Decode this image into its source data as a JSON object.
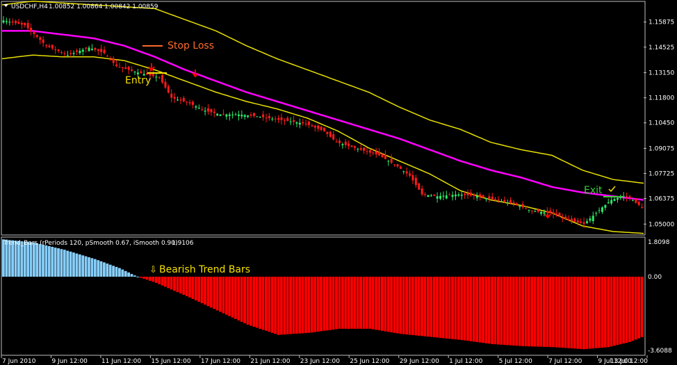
{
  "header": {
    "symbol": "USDCHF,H4",
    "ohlc": "1.00852 1.00864 1.00842 1.00859"
  },
  "indicator": {
    "caption": "Trend_Bars  (rPeriods 120, pSmooth 0.67, iSmooth 0.90)",
    "current_value": "1.9106"
  },
  "annotations": {
    "stop_loss": "Stop Loss",
    "entry": "Entry",
    "exit": "Exit",
    "bearish": "Bearish Trend Bars",
    "colors": {
      "stop_loss": "#ff6a2a",
      "entry": "#f5e000",
      "exit": "#35d135",
      "bearish": "#f5e000"
    }
  },
  "chart_data": [
    {
      "type": "candlestick",
      "title": "USDCHF,H4",
      "price_ticks": [
        "1.15875",
        "1.14525",
        "1.13150",
        "1.11800",
        "1.10450",
        "1.09075",
        "1.07725",
        "1.06375",
        "1.05000"
      ],
      "ylim": [
        1.0445,
        1.1695
      ],
      "x_ticks": [
        "7 Jun 2010",
        "9 Jun 12:00",
        "11 Jun 12:00",
        "15 Jun 12:00",
        "17 Jun 12:00",
        "21 Jun 12:00",
        "23 Jun 12:00",
        "25 Jun 12:00",
        "29 Jun 12:00",
        "1 Jul 12:00",
        "5 Jul 12:00",
        "7 Jul 12:00",
        "9 Jul 12:00",
        "13 Jul 12:00"
      ],
      "close_path": [
        [
          0,
          1.16
        ],
        [
          8,
          1.157
        ],
        [
          15,
          1.146
        ],
        [
          22,
          1.141
        ],
        [
          29,
          1.145
        ],
        [
          34,
          1.142
        ],
        [
          38,
          1.135
        ],
        [
          44,
          1.132
        ],
        [
          49,
          1.13
        ],
        [
          52,
          1.129
        ],
        [
          56,
          1.118
        ],
        [
          62,
          1.115
        ],
        [
          67,
          1.111
        ],
        [
          72,
          1.109
        ],
        [
          78,
          1.109
        ],
        [
          84,
          1.108
        ],
        [
          92,
          1.106
        ],
        [
          96,
          1.105
        ],
        [
          100,
          1.104
        ],
        [
          106,
          1.1
        ],
        [
          110,
          1.094
        ],
        [
          114,
          1.092
        ],
        [
          118,
          1.09
        ],
        [
          124,
          1.087
        ],
        [
          130,
          1.081
        ],
        [
          134,
          1.076
        ],
        [
          138,
          1.066
        ],
        [
          143,
          1.065
        ],
        [
          150,
          1.066
        ],
        [
          156,
          1.065
        ],
        [
          162,
          1.063
        ],
        [
          168,
          1.061
        ],
        [
          174,
          1.057
        ],
        [
          180,
          1.056
        ],
        [
          186,
          1.052
        ],
        [
          191,
          1.05
        ],
        [
          197,
          1.059
        ],
        [
          200,
          1.063
        ],
        [
          204,
          1.065
        ],
        [
          206,
          1.064
        ],
        [
          210,
          1.059
        ]
      ],
      "series": [
        {
          "name": "",
          "color": "#ff00ff",
          "values": [
            [
              0,
              1.154
            ],
            [
              10,
              1.154
            ],
            [
              20,
              1.152
            ],
            [
              30,
              1.15
            ],
            [
              40,
              1.146
            ],
            [
              50,
              1.14
            ],
            [
              60,
              1.133
            ],
            [
              70,
              1.127
            ],
            [
              80,
              1.121
            ],
            [
              90,
              1.116
            ],
            [
              100,
              1.111
            ],
            [
              110,
              1.106
            ],
            [
              120,
              1.101
            ],
            [
              130,
              1.096
            ],
            [
              140,
              1.09
            ],
            [
              150,
              1.084
            ],
            [
              160,
              1.079
            ],
            [
              170,
              1.075
            ],
            [
              180,
              1.07
            ],
            [
              190,
              1.067
            ],
            [
              200,
              1.065
            ],
            [
              210,
              1.063
            ]
          ]
        },
        {
          "name": "",
          "color": "#e8e000",
          "values": [
            [
              0,
              1.168
            ],
            [
              10,
              1.17
            ],
            [
              20,
              1.169
            ],
            [
              30,
              1.168
            ],
            [
              40,
              1.167
            ],
            [
              50,
              1.166
            ],
            [
              60,
              1.16
            ],
            [
              70,
              1.154
            ],
            [
              80,
              1.146
            ],
            [
              90,
              1.139
            ],
            [
              100,
              1.133
            ],
            [
              110,
              1.127
            ],
            [
              120,
              1.121
            ],
            [
              130,
              1.113
            ],
            [
              140,
              1.106
            ],
            [
              150,
              1.101
            ],
            [
              160,
              1.094
            ],
            [
              170,
              1.09
            ],
            [
              180,
              1.087
            ],
            [
              190,
              1.079
            ],
            [
              200,
              1.074
            ],
            [
              210,
              1.072
            ]
          ]
        },
        {
          "name": "",
          "color": "#e8e000",
          "values": [
            [
              0,
              1.139
            ],
            [
              10,
              1.141
            ],
            [
              20,
              1.14
            ],
            [
              30,
              1.14
            ],
            [
              40,
              1.138
            ],
            [
              50,
              1.133
            ],
            [
              60,
              1.127
            ],
            [
              70,
              1.121
            ],
            [
              80,
              1.116
            ],
            [
              90,
              1.112
            ],
            [
              100,
              1.107
            ],
            [
              110,
              1.1
            ],
            [
              120,
              1.091
            ],
            [
              130,
              1.084
            ],
            [
              140,
              1.077
            ],
            [
              150,
              1.068
            ],
            [
              160,
              1.063
            ],
            [
              170,
              1.06
            ],
            [
              180,
              1.056
            ],
            [
              190,
              1.049
            ],
            [
              200,
              1.046
            ],
            [
              210,
              1.045
            ]
          ]
        }
      ]
    },
    {
      "type": "bar",
      "title": "Trend_Bars  (rPeriods 120, pSmooth 0.67, iSmooth 0.90)",
      "value_ticks": [
        "1.8098",
        "0.00",
        "-3.6088"
      ],
      "ylim": [
        -3.6088,
        1.8098
      ],
      "bar_count": 210,
      "colors": {
        "positive": "#87cefa",
        "negative": "#ff0000"
      },
      "value_path": [
        [
          0,
          1.8
        ],
        [
          10,
          1.65
        ],
        [
          20,
          1.3
        ],
        [
          30,
          0.85
        ],
        [
          38,
          0.42
        ],
        [
          43,
          0.06
        ],
        [
          45,
          -0.05
        ],
        [
          50,
          -0.3
        ],
        [
          60,
          -0.95
        ],
        [
          70,
          -1.65
        ],
        [
          80,
          -2.35
        ],
        [
          90,
          -2.85
        ],
        [
          100,
          -2.75
        ],
        [
          110,
          -2.55
        ],
        [
          120,
          -2.55
        ],
        [
          130,
          -2.8
        ],
        [
          140,
          -2.95
        ],
        [
          150,
          -3.1
        ],
        [
          160,
          -3.3
        ],
        [
          170,
          -3.4
        ],
        [
          180,
          -3.45
        ],
        [
          190,
          -3.55
        ],
        [
          198,
          -3.45
        ],
        [
          205,
          -3.2
        ],
        [
          210,
          -2.9
        ]
      ]
    }
  ]
}
